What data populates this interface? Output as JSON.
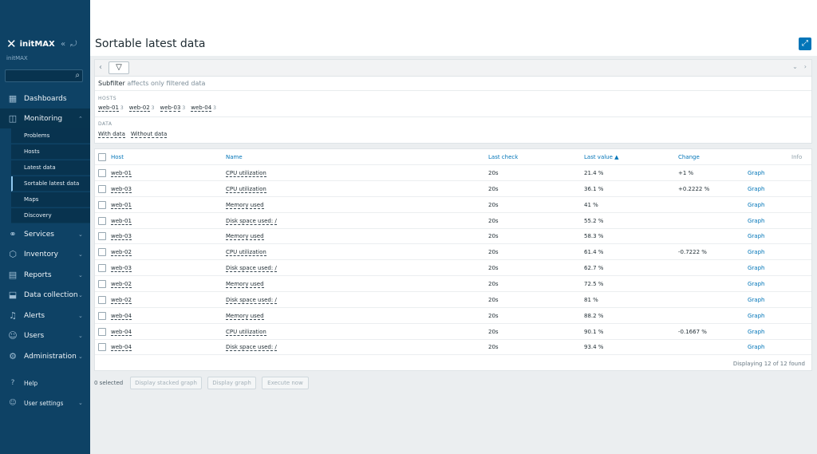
{
  "sidebar": {
    "brand": "initMAX",
    "brand_sub": "initMAX",
    "search_placeholder": "",
    "nav": [
      {
        "label": "Dashboards",
        "icon": "dashboards-icon",
        "glyph": "▦"
      },
      {
        "label": "Monitoring",
        "icon": "monitoring-icon",
        "glyph": "◫"
      },
      {
        "label": "Services",
        "icon": "services-icon",
        "glyph": "⚭"
      },
      {
        "label": "Inventory",
        "icon": "inventory-icon",
        "glyph": "⬡"
      },
      {
        "label": "Reports",
        "icon": "reports-icon",
        "glyph": "▤"
      },
      {
        "label": "Data collection",
        "icon": "data-collection-icon",
        "glyph": "⬓"
      },
      {
        "label": "Alerts",
        "icon": "alerts-icon",
        "glyph": "♫"
      },
      {
        "label": "Users",
        "icon": "users-icon",
        "glyph": "☺"
      },
      {
        "label": "Administration",
        "icon": "administration-icon",
        "glyph": "⚙"
      }
    ],
    "monitoring_sub": [
      "Problems",
      "Hosts",
      "Latest data",
      "Sortable latest data",
      "Maps",
      "Discovery"
    ],
    "bottom": [
      {
        "label": "Help",
        "icon": "help-icon",
        "glyph": "?"
      },
      {
        "label": "User settings",
        "icon": "user-settings-icon",
        "glyph": "☺"
      }
    ]
  },
  "header": {
    "title": "Sortable latest data"
  },
  "subfilter": {
    "title": "Subfilter",
    "hint": "affects only filtered data",
    "hosts_label": "HOSTS",
    "hosts": [
      {
        "name": "web-01",
        "count": "3"
      },
      {
        "name": "web-02",
        "count": "3"
      },
      {
        "name": "web-03",
        "count": "3"
      },
      {
        "name": "web-04",
        "count": "3"
      }
    ],
    "data_label": "DATA",
    "data": [
      "With data",
      "Without data"
    ]
  },
  "table": {
    "headers": {
      "host": "Host",
      "name": "Name",
      "last_check": "Last check",
      "last_value": "Last value ▲",
      "change": "Change",
      "info": "Info"
    },
    "rows": [
      {
        "host": "web-01",
        "name": "CPU utilization",
        "last_check": "20s",
        "last_value": "21.4 %",
        "change": "+1 %",
        "graph": "Graph"
      },
      {
        "host": "web-03",
        "name": "CPU utilization",
        "last_check": "20s",
        "last_value": "36.1 %",
        "change": "+0.2222 %",
        "graph": "Graph"
      },
      {
        "host": "web-01",
        "name": "Memory used",
        "last_check": "20s",
        "last_value": "41 %",
        "change": "",
        "graph": "Graph"
      },
      {
        "host": "web-01",
        "name": "Disk space used: /",
        "last_check": "20s",
        "last_value": "55.2 %",
        "change": "",
        "graph": "Graph"
      },
      {
        "host": "web-03",
        "name": "Memory used",
        "last_check": "20s",
        "last_value": "58.3 %",
        "change": "",
        "graph": "Graph"
      },
      {
        "host": "web-02",
        "name": "CPU utilization",
        "last_check": "20s",
        "last_value": "61.4 %",
        "change": "-0.7222 %",
        "graph": "Graph"
      },
      {
        "host": "web-03",
        "name": "Disk space used: /",
        "last_check": "20s",
        "last_value": "62.7 %",
        "change": "",
        "graph": "Graph"
      },
      {
        "host": "web-02",
        "name": "Memory used",
        "last_check": "20s",
        "last_value": "72.5 %",
        "change": "",
        "graph": "Graph"
      },
      {
        "host": "web-02",
        "name": "Disk space used: /",
        "last_check": "20s",
        "last_value": "81 %",
        "change": "",
        "graph": "Graph"
      },
      {
        "host": "web-04",
        "name": "Memory used",
        "last_check": "20s",
        "last_value": "88.2 %",
        "change": "",
        "graph": "Graph"
      },
      {
        "host": "web-04",
        "name": "CPU utilization",
        "last_check": "20s",
        "last_value": "90.1 %",
        "change": "-0.1667 %",
        "graph": "Graph"
      },
      {
        "host": "web-04",
        "name": "Disk space used: /",
        "last_check": "20s",
        "last_value": "93.4 %",
        "change": "",
        "graph": "Graph"
      }
    ],
    "footer": "Displaying 12 of 12 found"
  },
  "actions": {
    "selected": "0 selected",
    "display_stacked_graph": "Display stacked graph",
    "display_graph": "Display graph",
    "execute_now": "Execute now"
  },
  "colors": {
    "sidebar_bg": "#0e4265",
    "link": "#0275b8",
    "page_bg": "#ebeef0"
  }
}
